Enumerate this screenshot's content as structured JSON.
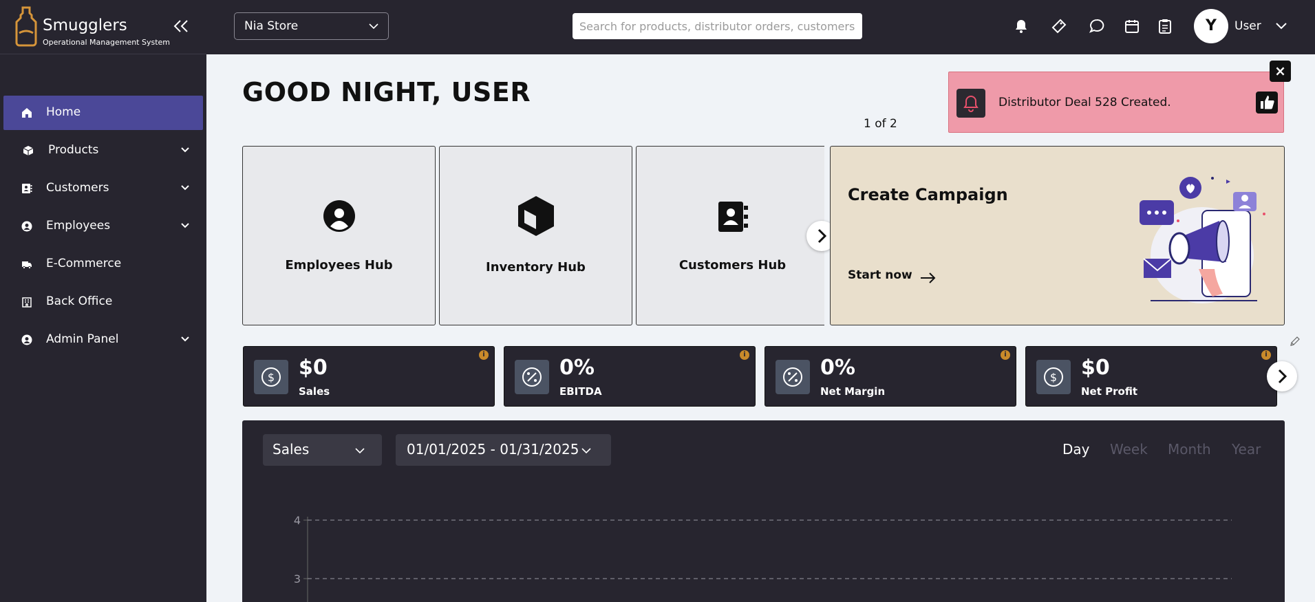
{
  "app": {
    "brand_name": "Smugglers",
    "brand_subtitle": "Operational Management System"
  },
  "sidebar": {
    "items": [
      {
        "label": "Home",
        "icon": "home-icon",
        "active": true,
        "expandable": false
      },
      {
        "label": "Products",
        "icon": "cube-icon",
        "active": false,
        "expandable": true
      },
      {
        "label": "Customers",
        "icon": "contacts-icon",
        "active": false,
        "expandable": true
      },
      {
        "label": "Employees",
        "icon": "user-circle-icon",
        "active": false,
        "expandable": true
      },
      {
        "label": "E-Commerce",
        "icon": "truck-icon",
        "active": false,
        "expandable": false
      },
      {
        "label": "Back Office",
        "icon": "office-icon",
        "active": false,
        "expandable": false
      },
      {
        "label": "Admin Panel",
        "icon": "user-circle-icon",
        "active": false,
        "expandable": true
      }
    ]
  },
  "header": {
    "store": "Nia Store",
    "search_placeholder": "Search for products, distributor orders, customers, o",
    "avatar_initial": "Y",
    "user_name": "User",
    "icons": [
      "bell-icon",
      "ticket-icon",
      "chat-icon",
      "calendar-icon",
      "clipboard-icon"
    ]
  },
  "main": {
    "greeting": "GOOD NIGHT, USER",
    "pager": "1 of 2",
    "hubs": [
      {
        "label": "Employees Hub",
        "icon": "user-circle-icon"
      },
      {
        "label": "Inventory Hub",
        "icon": "cube-icon"
      },
      {
        "label": "Customers Hub",
        "icon": "contacts-icon"
      }
    ],
    "campaign": {
      "title": "Create Campaign",
      "link": "Start now"
    }
  },
  "toast": {
    "message": "Distributor Deal 528 Created.",
    "close": "×"
  },
  "kpis": [
    {
      "value": "$0",
      "label": "Sales",
      "icon": "dollar-icon"
    },
    {
      "value": "0%",
      "label": "EBITDA",
      "icon": "percent-icon"
    },
    {
      "value": "0%",
      "label": "Net Margin",
      "icon": "percent-icon"
    },
    {
      "value": "$0",
      "label": "Net Profit",
      "icon": "dollar-icon"
    }
  ],
  "chart": {
    "metric": "Sales",
    "date_range": "01/01/2025 - 01/31/2025",
    "ranges": [
      "Day",
      "Week",
      "Month",
      "Year"
    ],
    "active_range": "Day"
  },
  "chart_data": {
    "type": "line",
    "y_ticks": [
      "4",
      "3"
    ],
    "grid": true,
    "series": []
  }
}
